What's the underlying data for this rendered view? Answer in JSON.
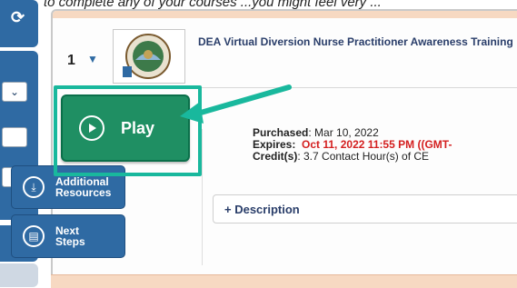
{
  "header": {
    "caption": "to complete any of your courses ...you might feel very ..."
  },
  "course": {
    "row_number": "1",
    "row_caret": "▼",
    "title": "DEA Virtual Diversion Nurse Practitioner Awareness Training",
    "purchased_label": "Purchased",
    "purchased_value": ": Mar 10, 2022",
    "expires_label": "Expires:",
    "expires_value": "Oct 11, 2022 11:55 PM ((GMT-",
    "credits_label": "Credit(s)",
    "credits_value": ": 3.7 Contact Hour(s) of CE"
  },
  "actions": {
    "play_label": "Play",
    "resources_label_line1": "Additional",
    "resources_label_line2": "Resources",
    "next_label_line1": "Next",
    "next_label_line2": "Steps"
  },
  "description": {
    "label": "+ Description"
  },
  "colors": {
    "accent_blue": "#2f6aa3",
    "play_green": "#1f8f63",
    "highlight_teal": "#19b89d",
    "expires_red": "#d42020"
  },
  "icons": [
    "refresh-icon",
    "chevron-down-icon",
    "play-circle-icon",
    "download-circle-icon",
    "steps-icon",
    "arrow-pointer"
  ]
}
